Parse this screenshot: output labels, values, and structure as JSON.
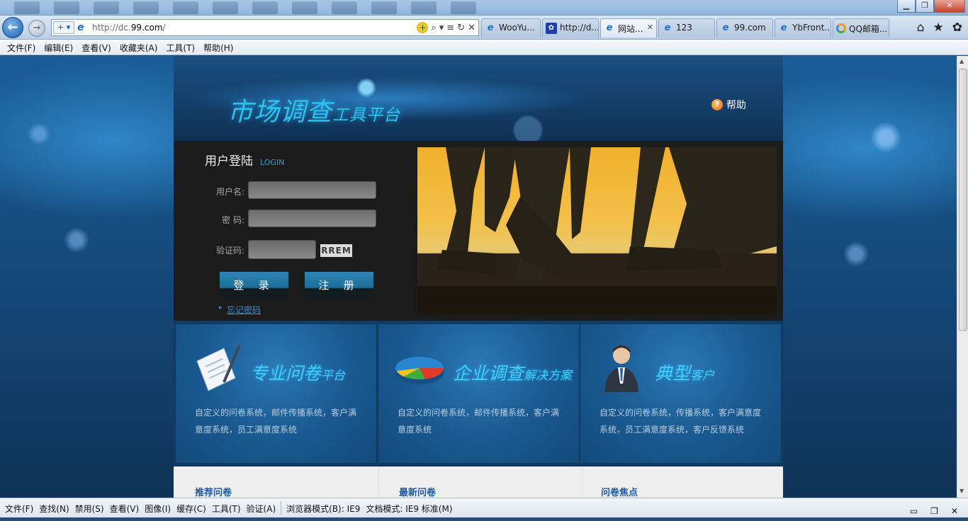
{
  "window": {
    "minimize_glyph": "▁",
    "restore_glyph": "❐",
    "close_glyph": "✕"
  },
  "nav": {
    "back_glyph": "←",
    "forward_glyph": "→",
    "address_prefix": "http://dc.",
    "address_domain": "99.com",
    "address_suffix": "/",
    "tools": [
      "+",
      "⌕",
      "▾",
      "≡",
      "↻",
      "✕"
    ],
    "home_glyph": "⌂",
    "fav_glyph": "★",
    "settings_glyph": "✿"
  },
  "tabs": [
    {
      "label": "WooYu...",
      "icon": "ie-icon"
    },
    {
      "label": "http://d...",
      "icon": "baidu-icon"
    },
    {
      "label": "网站...",
      "icon": "ie-icon",
      "active": true
    },
    {
      "label": "123",
      "icon": "ie-icon"
    },
    {
      "label": "99.com",
      "icon": "ie-icon"
    },
    {
      "label": "YbFront...",
      "icon": "ie-icon"
    },
    {
      "label": "QQ邮箱...",
      "icon": "qq-icon"
    }
  ],
  "menu": [
    "文件(F)",
    "编辑(E)",
    "查看(V)",
    "收藏夹(A)",
    "工具(T)",
    "帮助(H)"
  ],
  "header": {
    "logo_main": "市场调查",
    "logo_sub": "工具平台",
    "help_label": "帮助"
  },
  "login": {
    "title": "用户登陆",
    "title_en": "LOGIN",
    "username_label": "用户名:",
    "password_label": "密 码:",
    "captcha_label": "验证码:",
    "captcha_text": "RREM",
    "login_button": "登 录",
    "register_button": "注 册",
    "forgot_link": "忘记密码"
  },
  "features": [
    {
      "title_main": "专业问卷",
      "title_sub": "平台",
      "icon": "questionnaire-icon",
      "desc": "自定义的问卷系统，邮件传播系统，客户满意度系统，员工满意度系统"
    },
    {
      "title_main": "企业调查",
      "title_sub": "解决方案",
      "icon": "pie-chart-icon",
      "desc": "自定义的问卷系统，邮件传播系统，客户满意度系统"
    },
    {
      "title_main": "典型",
      "title_sub": "客户",
      "icon": "businessman-icon",
      "desc": "自定义的问卷系统，传播系统，客户满意度系统，员工满意度系统，客户反馈系统"
    }
  ],
  "lists": [
    "推荐问卷",
    "最新问卷",
    "问卷焦点"
  ],
  "statusbar": {
    "items": [
      "文件(F)",
      "查找(N)",
      "禁用(S)",
      "查看(V)",
      "图像(I)",
      "缓存(C)",
      "工具(T)",
      "验证(A)"
    ],
    "browser_mode": "浏览器模式(B):  IE9",
    "doc_mode": "文档模式:  IE9 标准(M)"
  }
}
